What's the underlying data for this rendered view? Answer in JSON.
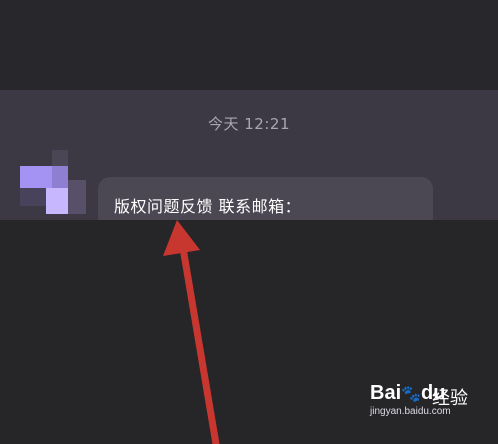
{
  "chat": {
    "timestamp": "今天 12:21",
    "message": "版权问题反馈 联系邮箱："
  },
  "watermark": {
    "logo": "Bai",
    "logo_paw": "🐾",
    "logo_suffix": "du",
    "brand": "经验",
    "url": "jingyan.baidu.com"
  },
  "colors": {
    "arrow": "#c8372f",
    "bubble": "#4b4753",
    "chat_band": "#3c3945"
  }
}
